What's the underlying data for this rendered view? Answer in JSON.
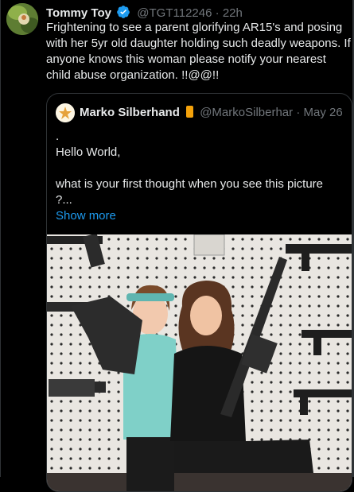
{
  "tweet": {
    "author_name": "Tommy Toy",
    "handle": "@TGT112246",
    "separator": "·",
    "time": "22h",
    "text": "Frightening to see a parent glorifying AR15's and posing with her 5yr old daughter holding such deadly weapons. If anyone knows this woman please notify your nearest child abuse organization.    !!@@!!"
  },
  "quote": {
    "author_name": "Marko Silberhand",
    "handle": "@MarkoSilberhar",
    "separator": "·",
    "date": "May 26",
    "lines": [
      ".",
      "Hello World,",
      "",
      "what is your first thought when you see this picture",
      "?..."
    ],
    "show_more": "Show more"
  },
  "colors": {
    "background": "#000000",
    "text": "#e7e9ea",
    "muted": "#71767b",
    "link": "#1d9bf0",
    "verified": "#1d9bf0",
    "badge": "#f4a20b",
    "border": "#2f3336"
  }
}
